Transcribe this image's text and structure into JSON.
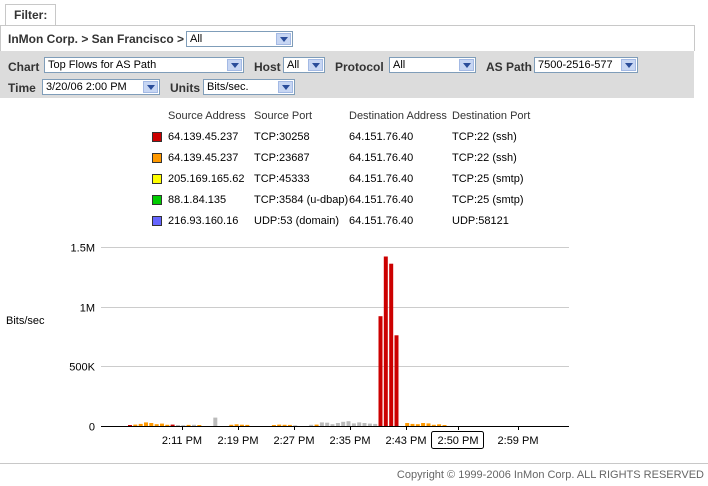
{
  "filter": {
    "tab_label": "Filter:",
    "breadcrumb": "InMon Corp. > San Francisco >",
    "site_select": "All"
  },
  "controls": {
    "chart_label": "Chart",
    "chart_value": "Top Flows for AS Path",
    "host_label": "Host",
    "host_value": "All",
    "protocol_label": "Protocol",
    "protocol_value": "All",
    "aspath_label": "AS Path",
    "aspath_value": "7500-2516-577",
    "time_label": "Time",
    "time_value": "3/20/06 2:00 PM",
    "units_label": "Units",
    "units_value": "Bits/sec."
  },
  "legend": {
    "headers": [
      "Source Address",
      "Source Port",
      "Destination Address",
      "Destination Port"
    ],
    "rows": [
      {
        "color": "#cc0000",
        "src": "64.139.45.237",
        "sport": "TCP:30258",
        "dst": "64.151.76.40",
        "dport": "TCP:22 (ssh)"
      },
      {
        "color": "#ff9900",
        "src": "64.139.45.237",
        "sport": "TCP:23687",
        "dst": "64.151.76.40",
        "dport": "TCP:22 (ssh)"
      },
      {
        "color": "#ffff00",
        "src": "205.169.165.62",
        "sport": "TCP:45333",
        "dst": "64.151.76.40",
        "dport": "TCP:25 (smtp)"
      },
      {
        "color": "#00cc00",
        "src": "88.1.84.135",
        "sport": "TCP:3584 (u-dbap)",
        "dst": "64.151.76.40",
        "dport": "TCP:25 (smtp)"
      },
      {
        "color": "#6666ff",
        "src": "216.93.160.16",
        "sport": "UDP:53 (domain)",
        "dst": "64.151.76.40",
        "dport": "UDP:58121"
      }
    ]
  },
  "chart_data": {
    "type": "bar",
    "ylabel": "Bits/sec",
    "ylim": [
      0,
      1500000
    ],
    "yticks": [
      {
        "value": 0,
        "label": "0"
      },
      {
        "value": 500000,
        "label": "500K"
      },
      {
        "value": 1000000,
        "label": "1M"
      },
      {
        "value": 1500000,
        "label": "1.5M"
      }
    ],
    "xticks": [
      "2:11 PM",
      "2:19 PM",
      "2:27 PM",
      "2:35 PM",
      "2:43 PM",
      "2:50 PM",
      "2:59 PM"
    ],
    "selected_xtick": "2:50 PM",
    "grid": true,
    "bars": [
      {
        "minute": 0,
        "value": 8000,
        "color": "#cc0000"
      },
      {
        "minute": 1,
        "value": 12000,
        "color": "#ff9900"
      },
      {
        "minute": 2,
        "value": 18000,
        "color": "#ff9900"
      },
      {
        "minute": 3,
        "value": 30000,
        "color": "#ff9900"
      },
      {
        "minute": 4,
        "value": 25000,
        "color": "#ff9900"
      },
      {
        "minute": 5,
        "value": 15000,
        "color": "#ff9900"
      },
      {
        "minute": 6,
        "value": 20000,
        "color": "#ff9900"
      },
      {
        "minute": 7,
        "value": 10000,
        "color": "#ff9900"
      },
      {
        "minute": 8,
        "value": 12000,
        "color": "#cc0000"
      },
      {
        "minute": 9,
        "value": 8000,
        "color": "#bbbbbb"
      },
      {
        "minute": 10,
        "value": 7000,
        "color": "#bbbbbb"
      },
      {
        "minute": 11,
        "value": 9000,
        "color": "#ff9900"
      },
      {
        "minute": 12,
        "value": 10000,
        "color": "#bbbbbb"
      },
      {
        "minute": 13,
        "value": 8000,
        "color": "#ff9900"
      },
      {
        "minute": 16,
        "value": 70000,
        "color": "#bbbbbb"
      },
      {
        "minute": 19,
        "value": 10000,
        "color": "#ff9900"
      },
      {
        "minute": 20,
        "value": 14000,
        "color": "#ff9900"
      },
      {
        "minute": 21,
        "value": 11000,
        "color": "#ff9900"
      },
      {
        "minute": 22,
        "value": 9000,
        "color": "#ff9900"
      },
      {
        "minute": 27,
        "value": 8000,
        "color": "#ff9900"
      },
      {
        "minute": 28,
        "value": 12000,
        "color": "#ff9900"
      },
      {
        "minute": 29,
        "value": 10000,
        "color": "#ff9900"
      },
      {
        "minute": 30,
        "value": 9000,
        "color": "#ff9900"
      },
      {
        "minute": 31,
        "value": 6000,
        "color": "#bbbbbb"
      },
      {
        "minute": 34,
        "value": 10000,
        "color": "#bbbbbb"
      },
      {
        "minute": 35,
        "value": 12000,
        "color": "#ff9900"
      },
      {
        "minute": 36,
        "value": 30000,
        "color": "#bbbbbb"
      },
      {
        "minute": 37,
        "value": 28000,
        "color": "#bbbbbb"
      },
      {
        "minute": 38,
        "value": 15000,
        "color": "#bbbbbb"
      },
      {
        "minute": 39,
        "value": 25000,
        "color": "#bbbbbb"
      },
      {
        "minute": 40,
        "value": 35000,
        "color": "#bbbbbb"
      },
      {
        "minute": 41,
        "value": 40000,
        "color": "#bbbbbb"
      },
      {
        "minute": 42,
        "value": 22000,
        "color": "#bbbbbb"
      },
      {
        "minute": 43,
        "value": 30000,
        "color": "#bbbbbb"
      },
      {
        "minute": 44,
        "value": 25000,
        "color": "#bbbbbb"
      },
      {
        "minute": 45,
        "value": 20000,
        "color": "#bbbbbb"
      },
      {
        "minute": 46,
        "value": 18000,
        "color": "#bbbbbb"
      },
      {
        "minute": 47,
        "value": 920000,
        "color": "#cc0000"
      },
      {
        "minute": 48,
        "value": 1420000,
        "color": "#cc0000"
      },
      {
        "minute": 49,
        "value": 1360000,
        "color": "#cc0000"
      },
      {
        "minute": 50,
        "value": 760000,
        "color": "#cc0000"
      },
      {
        "minute": 52,
        "value": 25000,
        "color": "#ff9900"
      },
      {
        "minute": 53,
        "value": 18000,
        "color": "#ff9900"
      },
      {
        "minute": 54,
        "value": 15000,
        "color": "#ff9900"
      },
      {
        "minute": 55,
        "value": 25000,
        "color": "#ff9900"
      },
      {
        "minute": 56,
        "value": 22000,
        "color": "#ff9900"
      },
      {
        "minute": 57,
        "value": 10000,
        "color": "#ff9900"
      },
      {
        "minute": 58,
        "value": 14000,
        "color": "#ff9900"
      },
      {
        "minute": 59,
        "value": 8000,
        "color": "#ff9900"
      }
    ]
  },
  "footer": {
    "copyright": "Copyright © 1999-2006 InMon Corp. ALL RIGHTS RESERVED"
  }
}
